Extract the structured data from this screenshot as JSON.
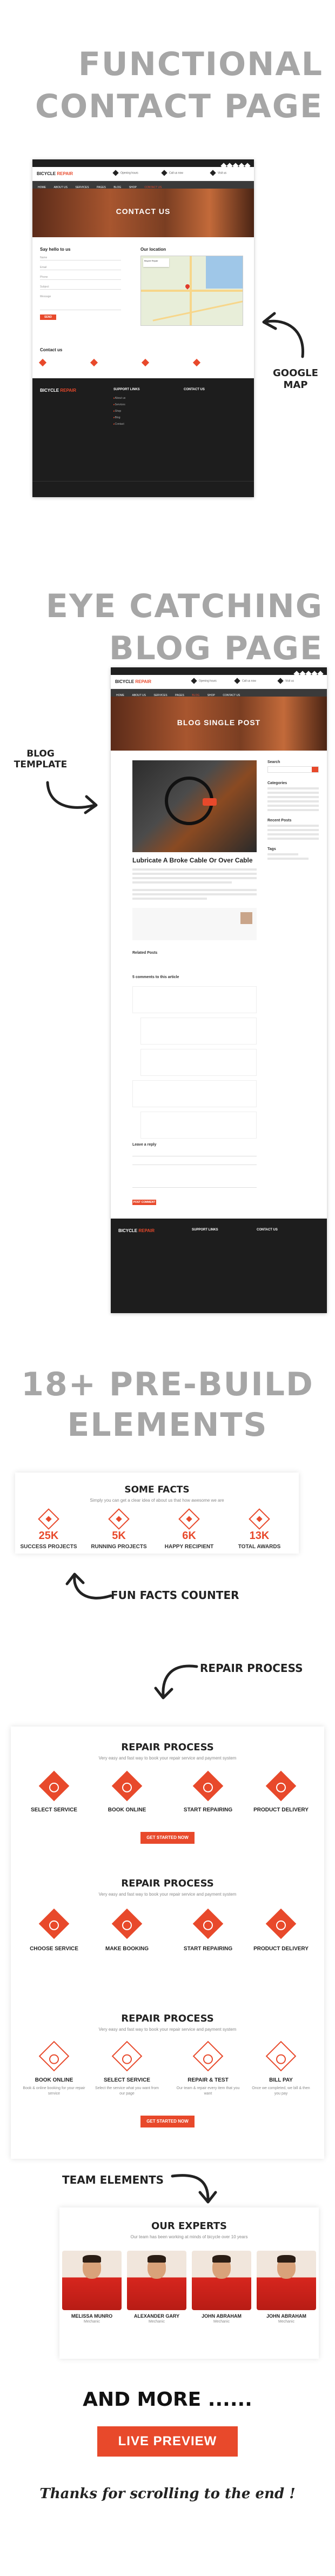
{
  "headings": {
    "contact_1": "FUNCTIONAL",
    "contact_2": "CONTACT PAGE",
    "blog_1": "EYE CATCHING",
    "blog_2": "BLOG PAGE",
    "elements_1": "18+ PRE-BUILD",
    "elements_2": "ELEMENTS"
  },
  "annotations": {
    "google_map": "GOOGLE MAP",
    "blog_template": "BLOG TEMPLATE",
    "fun_facts": "FUN FACTS COUNTER",
    "repair_process": "REPAIR PROCESS",
    "team_elements": "TEAM ELEMENTS"
  },
  "site": {
    "logo_a": "BICYCLE",
    "logo_b": "REPAIR",
    "nav": [
      "HOME",
      "ABOUT US",
      "SERVICES",
      "PAGES",
      "BLOG",
      "SHOP",
      "CONTACT US"
    ]
  },
  "contact_page": {
    "banner_title": "CONTACT US",
    "form_title": "Say hello to us",
    "fields": [
      "Name",
      "Email",
      "Phone",
      "Subject",
      "Message"
    ],
    "send_button": "SEND",
    "location_title": "Our location",
    "contact_title": "Contact us",
    "support_title": "SUPPORT LINKS",
    "contact_footer_title": "CONTACT US",
    "support_links": [
      "About us",
      "Services",
      "Shop",
      "Blog",
      "Contact"
    ]
  },
  "blog_page": {
    "banner_title": "BLOG SINGLE POST",
    "post_title": "Lubricate A Broke Cable Or Over Cable",
    "search_label": "Search",
    "categories_label": "Categories",
    "recent_posts_label": "Recent Posts",
    "tags_label": "Tags",
    "related_label": "Related Posts",
    "comments_label": "5 comments to this article",
    "leave_reply": "Leave a reply",
    "post_comment": "POST COMMENT"
  },
  "fun_facts": {
    "title": "SOME FACTS",
    "subtitle": "Simply you can get a clear idea of about us that how awesome we are",
    "items": [
      {
        "num": "25K",
        "label": "SUCCESS PROJECTS"
      },
      {
        "num": "5K",
        "label": "RUNNING PROJECTS"
      },
      {
        "num": "6K",
        "label": "HAPPY RECIPIENT"
      },
      {
        "num": "13K",
        "label": "TOTAL AWARDS"
      }
    ]
  },
  "repair_1": {
    "title": "REPAIR PROCESS",
    "subtitle": "Very easy and fast way to book your repair service and payment system",
    "steps": [
      "SELECT SERVICE",
      "BOOK ONLINE",
      "START REPAIRING",
      "PRODUCT DELIVERY"
    ],
    "button": "GET STARTED NOW"
  },
  "repair_2": {
    "title": "REPAIR PROCESS",
    "subtitle": "Very easy and fast way to book your repair service and payment system",
    "steps": [
      "CHOOSE SERVICE",
      "MAKE BOOKING",
      "START REPAIRING",
      "PRODUCT DELIVERY"
    ]
  },
  "repair_3": {
    "title": "REPAIR PROCESS",
    "subtitle": "Very easy and fast way to book your repair service and payment system",
    "steps": [
      "BOOK ONLINE",
      "SELECT SERVICE",
      "REPAIR & TEST",
      "BILL PAY"
    ],
    "texts": [
      "Book & online booking for your repair service",
      "Select the service what you want from our page",
      "Our team & repair every item that you want",
      "Once we completed, we bill & then you pay"
    ],
    "button": "GET STARTED NOW"
  },
  "experts": {
    "title": "OUR EXPERTS",
    "subtitle": "Our team has been working at minds of bicycle over 10 years",
    "members": [
      {
        "name": "MELISSA MUNRO",
        "role": "Mechanic"
      },
      {
        "name": "ALEXANDER GARY",
        "role": "Mechanic"
      },
      {
        "name": "JOHN ABRAHAM",
        "role": "Mechanic"
      },
      {
        "name": "JOHN ABRAHAM",
        "role": "Mechanic"
      }
    ]
  },
  "closing": {
    "and_more": "AND MORE ......",
    "live_preview": "LIVE PREVIEW",
    "thanks": "Thanks for scrolling to the end !"
  },
  "colors": {
    "accent": "#e8492b",
    "dark": "#1d1d1d",
    "heading_gray": "#a6a6a6"
  }
}
